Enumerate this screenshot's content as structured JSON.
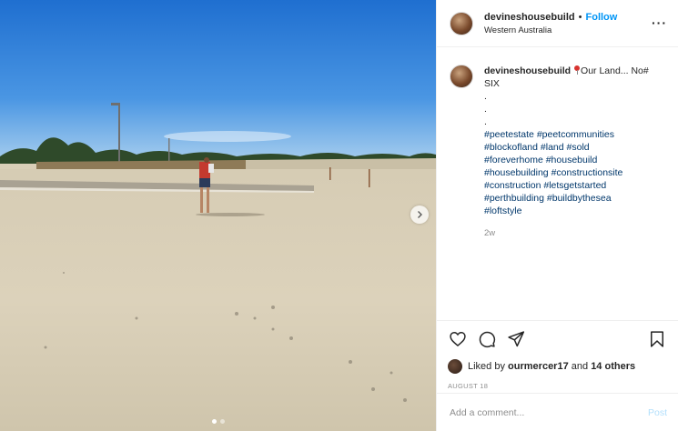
{
  "post": {
    "username": "devineshousebuild",
    "separator": "•",
    "follow_label": "Follow",
    "location": "Western Australia",
    "more_label": "···"
  },
  "caption": {
    "username": "devineshousebuild",
    "text_after_pin": "Our Land... No# SIX",
    "dots": [
      ".",
      ".",
      "."
    ],
    "hashtags": [
      "#peetestate",
      "#peetcommunities",
      "#blockofland",
      "#land",
      "#sold",
      "#foreverhome",
      "#housebuild",
      "#housebuilding",
      "#constructionsite",
      "#construction",
      "#letsgetstarted",
      "#perthbuilding",
      "#buildbythesea",
      "#loftstyle"
    ],
    "age": "2w"
  },
  "icons": {
    "like": "heart-icon",
    "comment": "comment-icon",
    "share": "share-icon",
    "save": "bookmark-icon",
    "next": "chevron-right-icon",
    "pin": "round-pushpin-icon"
  },
  "likes": {
    "prefix": "Liked by ",
    "user": "ourmercer17",
    "middle": " and ",
    "others": "14 others"
  },
  "date": "AUGUST 18",
  "comment_box": {
    "placeholder": "Add a comment...",
    "post_label": "Post"
  },
  "carousel": {
    "total": 2,
    "active_index": 0
  },
  "colors": {
    "link": "#0095f6",
    "hashtag": "#00376b",
    "muted": "#8e8e8e",
    "post_disabled": "#b2dffc"
  }
}
